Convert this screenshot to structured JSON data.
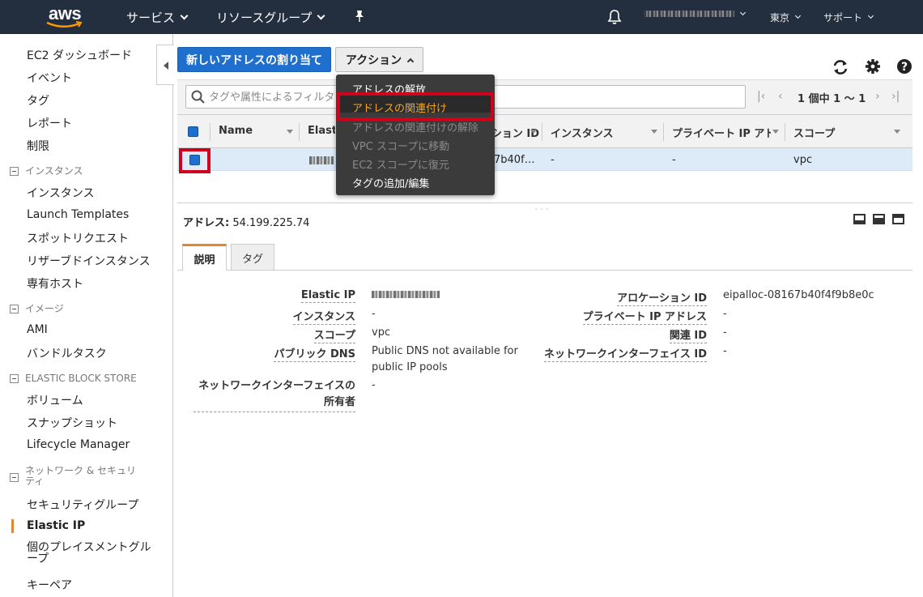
{
  "nav": {
    "services": "サービス",
    "resource_groups": "リソースグループ",
    "region": "東京",
    "support": "サポート"
  },
  "sidebar": {
    "items": [
      "EC2 ダッシュボード",
      "イベント",
      "タグ",
      "レポート",
      "制限"
    ],
    "sections": [
      {
        "title": "インスタンス",
        "items": [
          "インスタンス",
          "Launch Templates",
          "スポットリクエスト",
          "リザーブドインスタンス",
          "専有ホスト"
        ]
      },
      {
        "title": "イメージ",
        "items": [
          "AMI",
          "バンドルタスク"
        ]
      },
      {
        "title": "ELASTIC BLOCK STORE",
        "items": [
          "ボリューム",
          "スナップショット",
          "Lifecycle Manager"
        ]
      },
      {
        "title": "ネットワーク & セキュリティ",
        "items": [
          "セキュリティグループ",
          "Elastic IP",
          "個のプレイスメントグループ",
          "キーペア"
        ]
      }
    ],
    "active": "Elastic IP"
  },
  "toolbar": {
    "allocate_label": "新しいアドレスの割り当て",
    "actions_label": "アクション"
  },
  "menu": {
    "items": [
      {
        "label": "アドレスの解放",
        "state": "enabled"
      },
      {
        "label": "アドレスの関連付け",
        "state": "active"
      },
      {
        "label": "アドレスの関連付けの解除",
        "state": "disabled"
      },
      {
        "label": "VPC スコープに移動",
        "state": "disabled"
      },
      {
        "label": "EC2 スコープに復元",
        "state": "disabled"
      },
      {
        "label": "タグの追加/編集",
        "state": "enabled"
      }
    ]
  },
  "filter": {
    "placeholder": "タグや属性によるフィルタ",
    "pagination": "1 個中 1 〜 1"
  },
  "table": {
    "columns": [
      "Name",
      "Elastic IP",
      "アロケーション ID",
      "インスタンス",
      "プライベート IP アドレス",
      "スコープ"
    ],
    "row": {
      "allocation_partial": "7b40f…",
      "instance": "-",
      "private_ip": "-",
      "scope": "vpc"
    }
  },
  "details": {
    "address_label": "アドレス:",
    "address_value": "54.199.225.74",
    "tabs": [
      "説明",
      "タグ"
    ],
    "left": [
      {
        "label": "Elastic IP",
        "value": ""
      },
      {
        "label": "インスタンス",
        "value": "-"
      },
      {
        "label": "スコープ",
        "value": "vpc"
      },
      {
        "label": "パブリック DNS",
        "value": "Public DNS not available for public IP pools"
      },
      {
        "label": "ネットワークインターフェイスの所有者",
        "value": "-"
      }
    ],
    "right": [
      {
        "label": "アロケーション ID",
        "value": "eipalloc-08167b40f4f9b8e0c"
      },
      {
        "label": "プライベート IP アドレス",
        "value": "-"
      },
      {
        "label": "関連 ID",
        "value": "-"
      },
      {
        "label": "ネットワークインターフェイス ID",
        "value": "-"
      }
    ]
  },
  "colors": {
    "nav_bg": "#232f3e",
    "primary": "#1f6fcf",
    "accent": "#e7852e",
    "highlight_red": "#d0021b",
    "selected_row": "#ddeaf8"
  }
}
